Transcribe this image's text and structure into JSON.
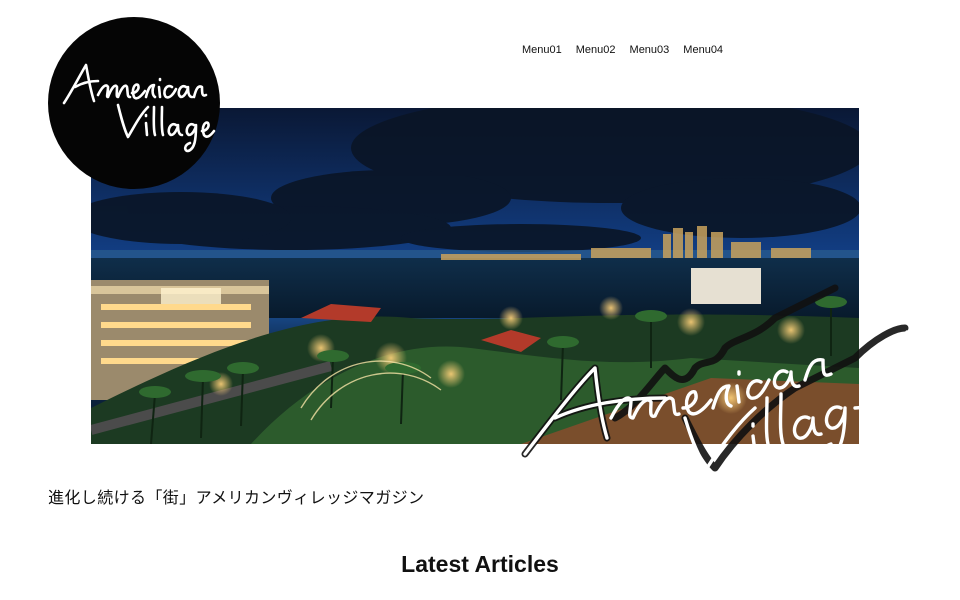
{
  "header": {
    "logo_text": "American Village",
    "nav": [
      {
        "label": "Menu01"
      },
      {
        "label": "Menu02"
      },
      {
        "label": "Menu03"
      },
      {
        "label": "Menu04"
      }
    ]
  },
  "hero": {
    "image": "night-panorama-of-american-village-waterfront",
    "overlay_script_text": "American Village"
  },
  "tagline": "進化し続ける「街」アメリカンヴィレッジマガジン",
  "latest": {
    "title": "Latest Articles"
  }
}
